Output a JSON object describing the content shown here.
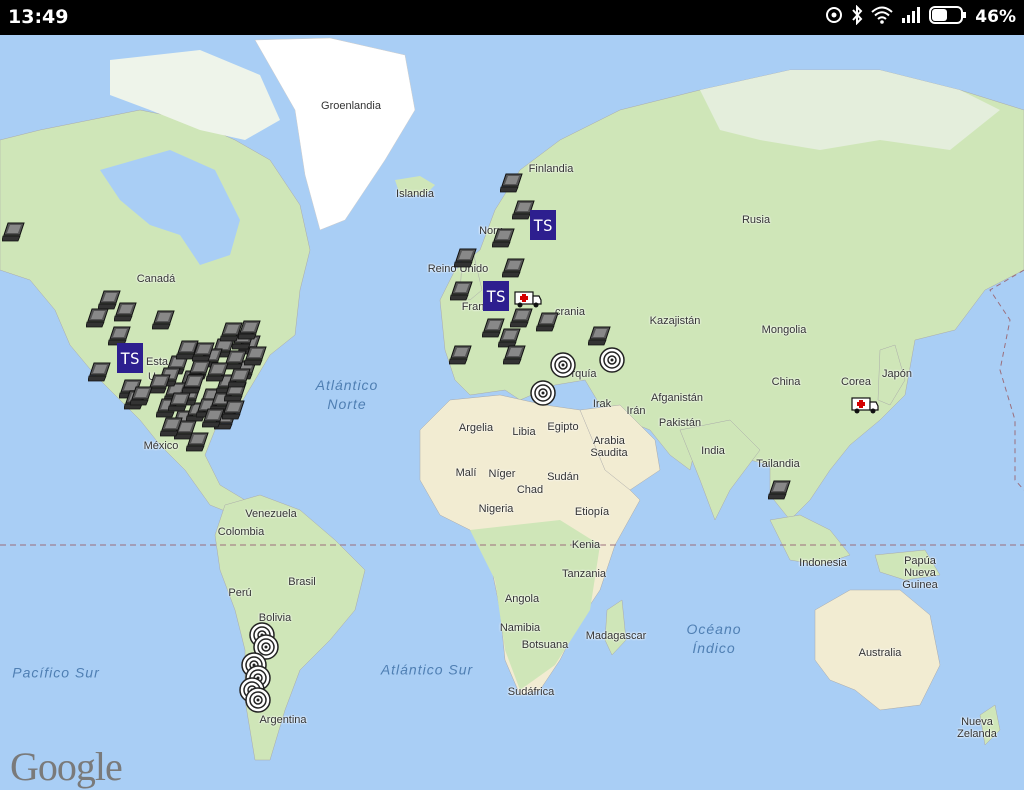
{
  "status_bar": {
    "time": "13:49",
    "battery": "46%"
  },
  "map": {
    "labels": [
      {
        "id": "groenlandia",
        "text": "Groenlandia"
      },
      {
        "id": "islandia",
        "text": "Islandia"
      },
      {
        "id": "finlandia",
        "text": "Finlandia"
      },
      {
        "id": "noruega",
        "text": "Noru"
      },
      {
        "id": "reino-unido",
        "text": "Reino Unido"
      },
      {
        "id": "francia",
        "text": "Fran"
      },
      {
        "id": "ucrania",
        "text": "crania"
      },
      {
        "id": "canada",
        "text": "Canadá"
      },
      {
        "id": "estados-unidos",
        "text": "Esta"
      },
      {
        "id": "estados-unidos-2",
        "text": "U"
      },
      {
        "id": "mexico",
        "text": "México"
      },
      {
        "id": "rusia",
        "text": "Rusia"
      },
      {
        "id": "kazajistan",
        "text": "Kazajistán"
      },
      {
        "id": "mongolia",
        "text": "Mongolia"
      },
      {
        "id": "china",
        "text": "China"
      },
      {
        "id": "corea",
        "text": "Corea"
      },
      {
        "id": "japon",
        "text": "Japón"
      },
      {
        "id": "turquia",
        "text": "rquía"
      },
      {
        "id": "irak",
        "text": "Irak"
      },
      {
        "id": "iran",
        "text": "Irán"
      },
      {
        "id": "afganistan",
        "text": "Afganistán"
      },
      {
        "id": "pakistan",
        "text": "Pakistán"
      },
      {
        "id": "india",
        "text": "India"
      },
      {
        "id": "arabia",
        "text": "Arabia\nSaudita"
      },
      {
        "id": "argelia",
        "text": "Argelia"
      },
      {
        "id": "libia",
        "text": "Libia"
      },
      {
        "id": "egipto",
        "text": "Egipto"
      },
      {
        "id": "mali",
        "text": "Malí"
      },
      {
        "id": "niger",
        "text": "Níger"
      },
      {
        "id": "chad",
        "text": "Chad"
      },
      {
        "id": "sudan",
        "text": "Sudán"
      },
      {
        "id": "nigeria",
        "text": "Nigeria"
      },
      {
        "id": "etiopia",
        "text": "Etiopía"
      },
      {
        "id": "kenia",
        "text": "Kenia"
      },
      {
        "id": "tanzania",
        "text": "Tanzania"
      },
      {
        "id": "angola",
        "text": "Angola"
      },
      {
        "id": "namibia",
        "text": "Namibia"
      },
      {
        "id": "botsuana",
        "text": "Botsuana"
      },
      {
        "id": "sudafrica",
        "text": "Sudáfrica"
      },
      {
        "id": "madagascar",
        "text": "Madagascar"
      },
      {
        "id": "tailandia",
        "text": "Tailandia"
      },
      {
        "id": "indonesia",
        "text": "Indonesia"
      },
      {
        "id": "papua",
        "text": "Papúa\nNueva\nGuinea"
      },
      {
        "id": "australia",
        "text": "Australia"
      },
      {
        "id": "nueva-zelanda",
        "text": "Nueva\nZelanda"
      },
      {
        "id": "venezuela",
        "text": "Venezuela"
      },
      {
        "id": "colombia",
        "text": "Colombia"
      },
      {
        "id": "brasil",
        "text": "Brasil"
      },
      {
        "id": "peru",
        "text": "Perú"
      },
      {
        "id": "bolivia",
        "text": "Bolivia"
      },
      {
        "id": "argentina",
        "text": "Argentina"
      }
    ],
    "oceans": [
      {
        "id": "atlantico-norte",
        "text": "Atlántico\nNorte"
      },
      {
        "id": "atlantico-sur",
        "text": "Atlántico Sur"
      },
      {
        "id": "pacifico-sur",
        "text": "Pacífico Sur"
      },
      {
        "id": "oceano-indico",
        "text": "Océano\nÍndico"
      }
    ],
    "marker_counts": {
      "laptop": 60,
      "target": 9,
      "ambulance": 2,
      "ts": 3
    },
    "marker_colors": {
      "ts": "#2d1f8f",
      "ambulance_cross": "#d40000"
    },
    "logo": "Google"
  }
}
